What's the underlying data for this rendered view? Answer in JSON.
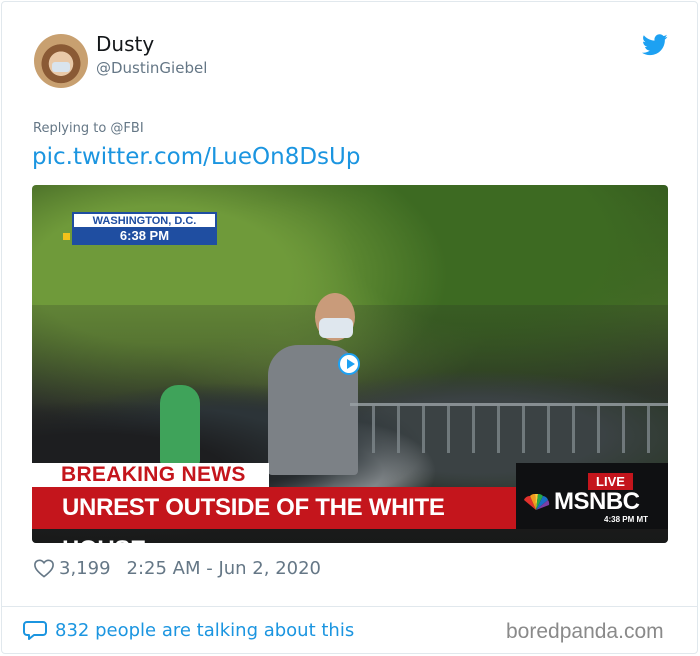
{
  "tweet": {
    "author": {
      "display_name": "Dusty",
      "handle": "@DustinGiebel",
      "avatar_icon": "avatar-photo"
    },
    "brand_icon": "twitter-bird-icon",
    "brand_color": "#1da1f2",
    "replying_to": "Replying to @FBI",
    "link": "pic.twitter.com/LueOn8DsUp",
    "media": {
      "location_label": "WASHINGTON, D.C.",
      "location_time": "6:38 PM",
      "breaking_label": "BREAKING NEWS",
      "headline": "UNREST OUTSIDE OF THE WHITE HOUSE",
      "live_label": "LIVE",
      "network": "MSNBC",
      "clock": "4:38 PM MT",
      "play_icon": "play-icon"
    },
    "likes": "3,199",
    "timestamp": "2:25 AM - Jun 2, 2020"
  },
  "footer": {
    "talking": "832 people are talking about this",
    "watermark": "boredpanda.com"
  },
  "colors": {
    "link": "#1b95e0",
    "muted": "#657786",
    "breaking_red": "#c4151c",
    "locator_blue": "#1f4ea1"
  }
}
